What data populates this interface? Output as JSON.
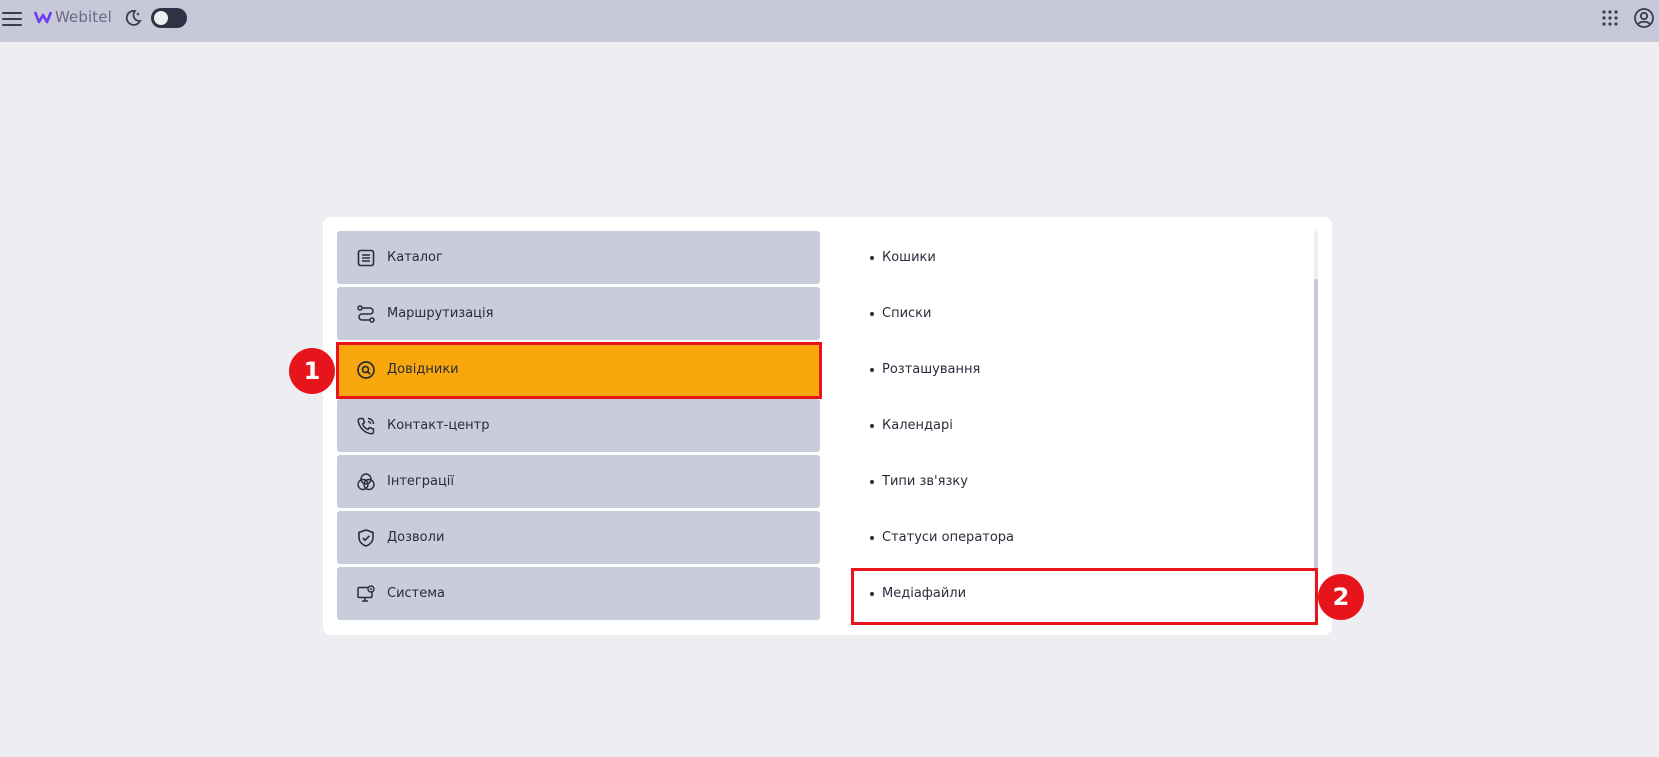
{
  "header": {
    "logo_text": "Webitel",
    "brand_color": "#6b3cf0",
    "icons": [
      "menu-icon",
      "moon-icon",
      "apps-grid-icon",
      "account-icon"
    ],
    "theme_toggle": "off"
  },
  "menu": {
    "items": [
      {
        "label": "Каталог",
        "icon": "catalog-icon"
      },
      {
        "label": "Маршрутизація",
        "icon": "routing-icon"
      },
      {
        "label": "Довідники",
        "icon": "directory-search-icon",
        "active": true
      },
      {
        "label": "Контакт-центр",
        "icon": "phone-icon"
      },
      {
        "label": "Інтеграції",
        "icon": "integrations-icon"
      },
      {
        "label": "Дозволи",
        "icon": "shield-check-icon"
      },
      {
        "label": "Система",
        "icon": "system-monitor-icon"
      }
    ],
    "active_color": "#f8a80c"
  },
  "submenu": {
    "items": [
      {
        "label": "Кошики"
      },
      {
        "label": "Списки"
      },
      {
        "label": "Розташування"
      },
      {
        "label": "Календарі"
      },
      {
        "label": "Типи зв'язку"
      },
      {
        "label": "Статуси оператора"
      },
      {
        "label": "Медіафайли"
      }
    ]
  },
  "annotations": {
    "markers": [
      "1",
      "2"
    ],
    "color": "#e8141c"
  }
}
